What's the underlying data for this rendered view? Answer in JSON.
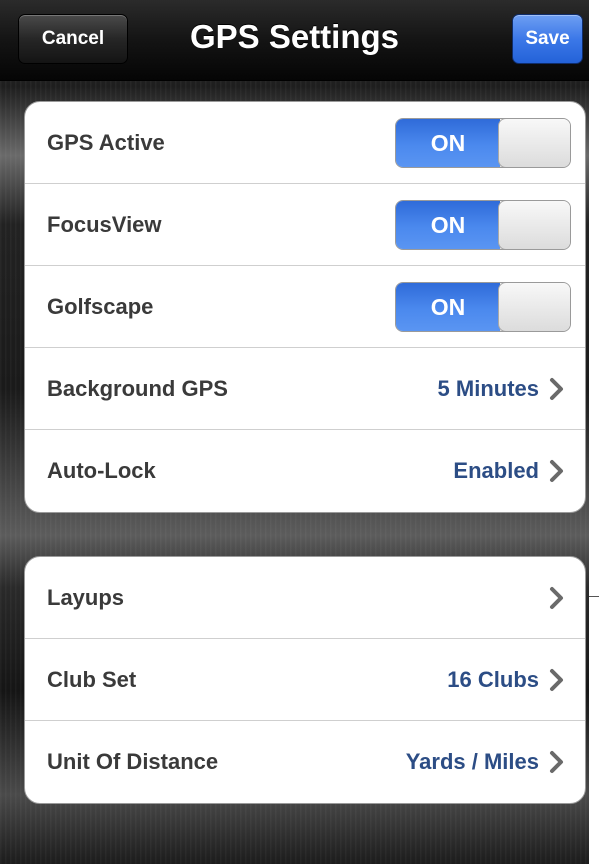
{
  "navbar": {
    "title": "GPS Settings",
    "cancel_label": "Cancel",
    "save_label": "Save"
  },
  "group1": {
    "rows": [
      {
        "label": "GPS Active",
        "type": "toggle",
        "value": "ON"
      },
      {
        "label": "FocusView",
        "type": "toggle",
        "value": "ON"
      },
      {
        "label": "Golfscape",
        "type": "toggle",
        "value": "ON"
      },
      {
        "label": "Background GPS",
        "type": "disclosure",
        "value": "5 Minutes"
      },
      {
        "label": "Auto-Lock",
        "type": "disclosure",
        "value": "Enabled"
      }
    ]
  },
  "group2": {
    "rows": [
      {
        "label": "Layups",
        "type": "disclosure",
        "value": ""
      },
      {
        "label": "Club Set",
        "type": "disclosure",
        "value": "16 Clubs"
      },
      {
        "label": "Unit Of Distance",
        "type": "disclosure",
        "value": "Yards / Miles"
      }
    ]
  },
  "colors": {
    "accent": "#3c78e8",
    "value_text": "#2c4d85",
    "label_text": "#3a3a3a"
  },
  "icons": {
    "disclosure": "chevron-right-icon"
  }
}
